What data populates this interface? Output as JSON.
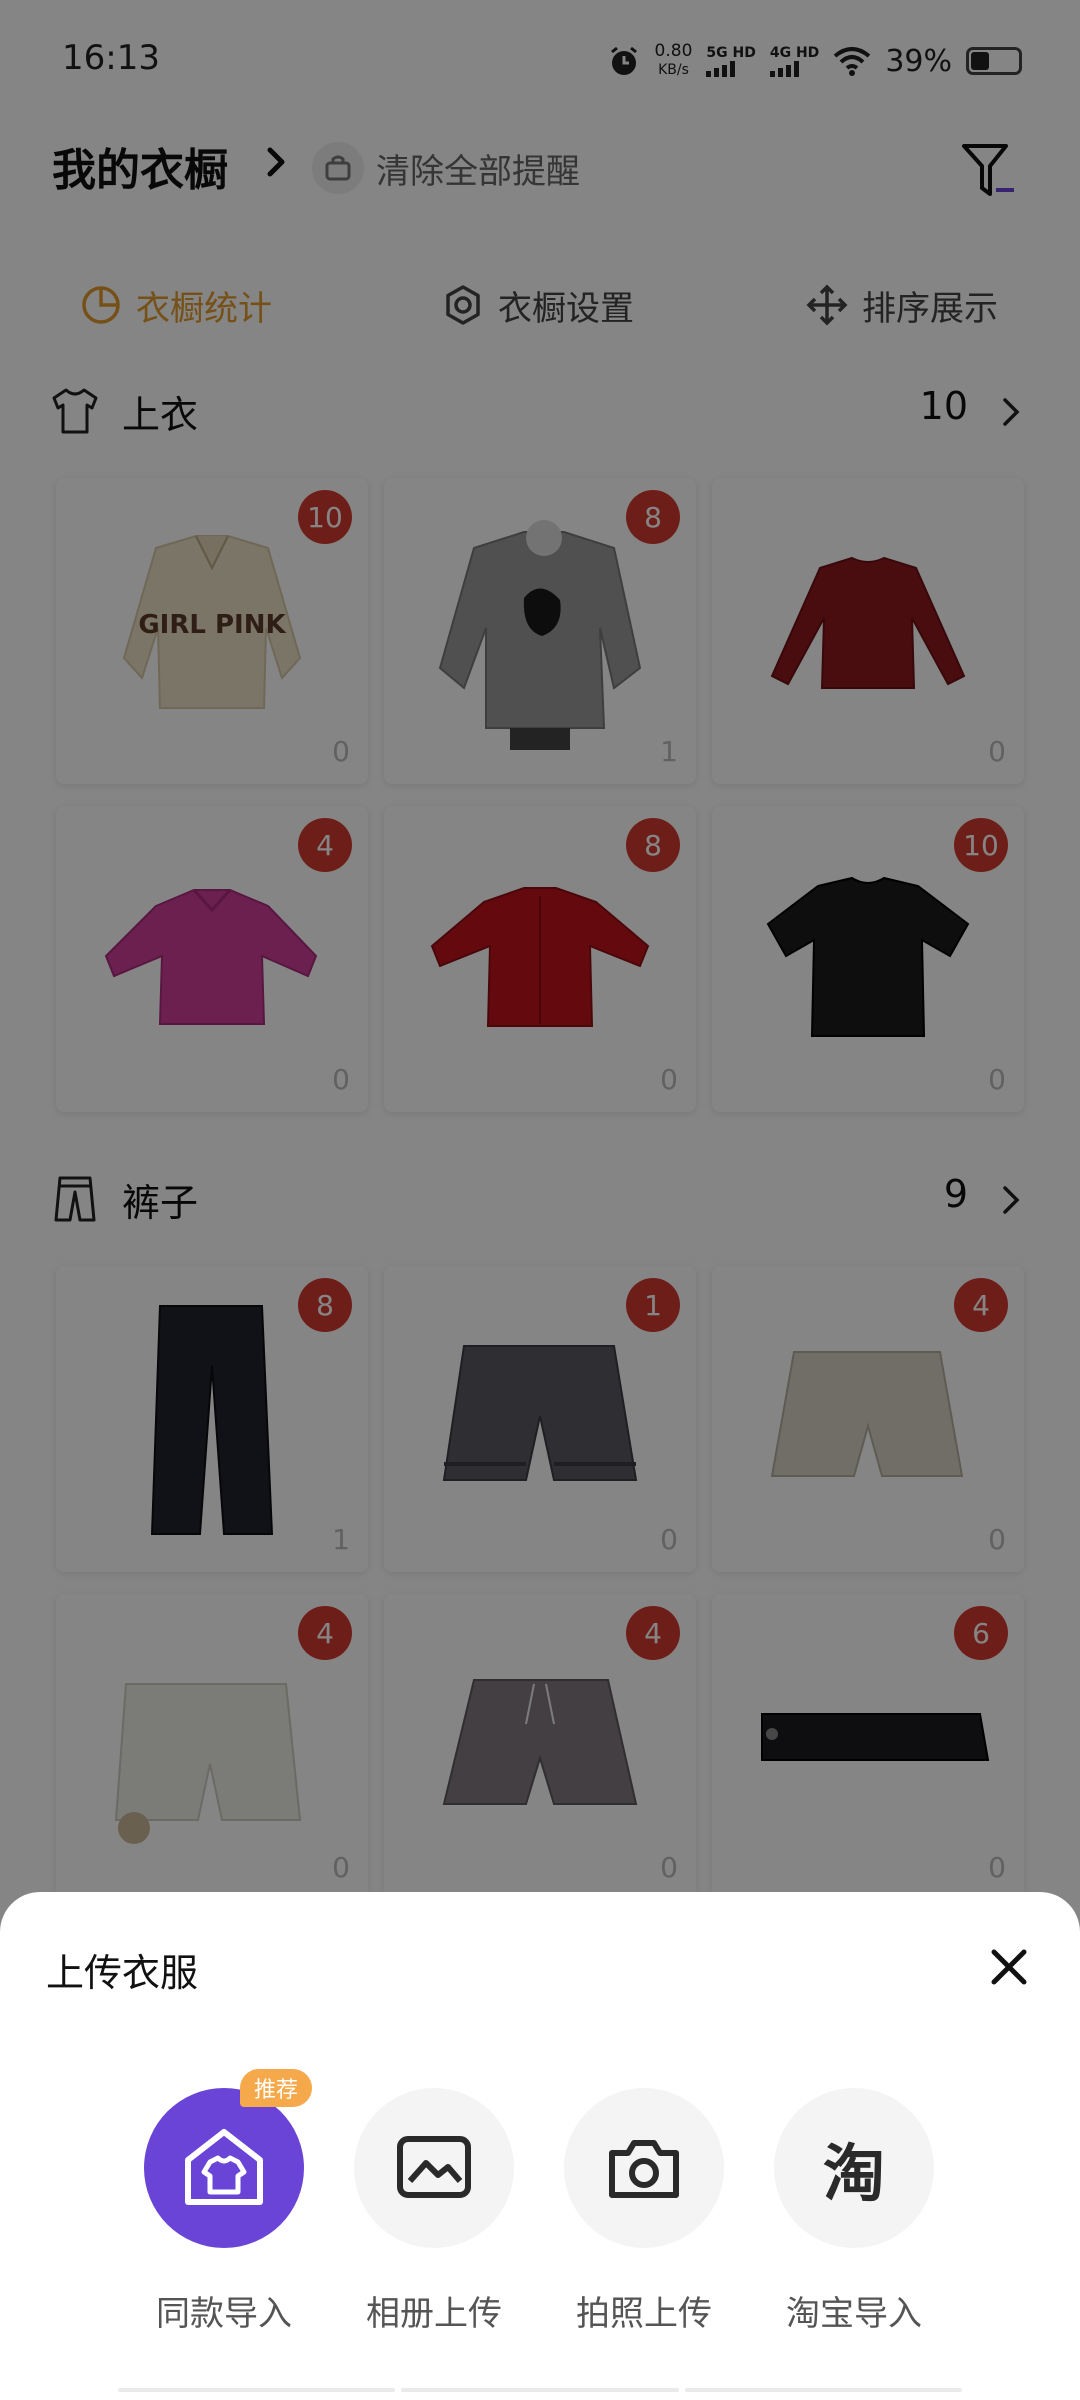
{
  "status_bar": {
    "time": "16:13",
    "net_speed_value": "0.80",
    "net_speed_unit": "KB/s",
    "net1": "5G HD",
    "net2": "4G HD",
    "battery": "39%"
  },
  "header": {
    "title": "我的衣橱",
    "clear_reminders": "清除全部提醒"
  },
  "tabs": [
    {
      "label": "衣橱统计"
    },
    {
      "label": "衣橱设置"
    },
    {
      "label": "排序展示"
    }
  ],
  "sections": [
    {
      "title": "上衣",
      "count": "10",
      "items": [
        {
          "badge": "10",
          "wear": "0"
        },
        {
          "badge": "8",
          "wear": "1"
        },
        {
          "badge": "",
          "wear": "0"
        },
        {
          "badge": "4",
          "wear": "0"
        },
        {
          "badge": "8",
          "wear": "0"
        },
        {
          "badge": "10",
          "wear": "0"
        }
      ]
    },
    {
      "title": "裤子",
      "count": "9",
      "items": [
        {
          "badge": "8",
          "wear": "1"
        },
        {
          "badge": "1",
          "wear": "0"
        },
        {
          "badge": "4",
          "wear": "0"
        },
        {
          "badge": "4",
          "wear": "0"
        },
        {
          "badge": "4",
          "wear": "0"
        },
        {
          "badge": "6",
          "wear": "0"
        }
      ]
    }
  ],
  "print_on_shirt": "GIRL PINK",
  "sheet": {
    "title": "上传衣服",
    "recommend_tag": "推荐",
    "options": [
      {
        "label": "同款导入",
        "icon": "wardrobe-import-icon"
      },
      {
        "label": "相册上传",
        "icon": "photo-album-icon"
      },
      {
        "label": "拍照上传",
        "icon": "camera-icon"
      },
      {
        "label": "淘宝导入",
        "icon": "taobao-icon",
        "glyph": "淘"
      }
    ]
  },
  "colors": {
    "accent_orange": "#e39b2d",
    "badge_red": "#d43b30",
    "primary_purple": "#6a44d6",
    "tag_orange": "#f6a94a"
  }
}
